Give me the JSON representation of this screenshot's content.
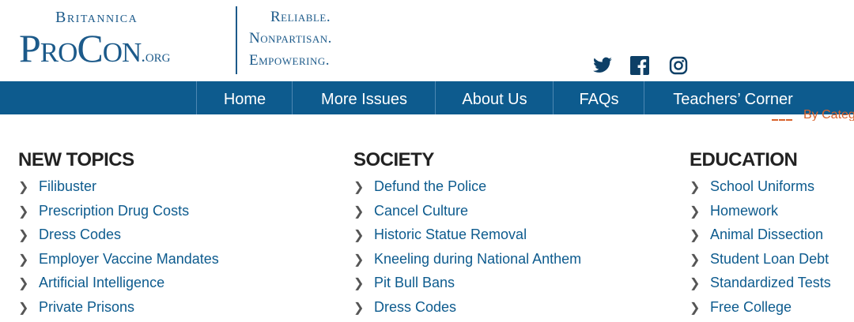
{
  "logo": {
    "top": "Britannica",
    "main": "ProCon",
    "suffix": ".org"
  },
  "tagline": [
    "Reliable.",
    "Nonpartisan.",
    "Empowering."
  ],
  "social": [
    "twitter-icon",
    "facebook-icon",
    "instagram-icon"
  ],
  "nav": [
    "Home",
    "More Issues",
    "About Us",
    "FAQs",
    "Teachers’ Corner"
  ],
  "category_link": "By Categ",
  "columns": [
    {
      "heading": "NEW TOPICS",
      "items": [
        "Filibuster",
        "Prescription Drug Costs",
        "Dress Codes",
        "Employer Vaccine Mandates",
        "Artificial Intelligence",
        "Private Prisons"
      ]
    },
    {
      "heading": "SOCIETY",
      "items": [
        "Defund the Police",
        "Cancel Culture",
        "Historic Statue Removal",
        "Kneeling during National Anthem",
        "Pit Bull Bans",
        "Dress Codes"
      ]
    },
    {
      "heading": "EDUCATION",
      "items": [
        "School Uniforms",
        "Homework",
        "Animal Dissection",
        "Student Loan Debt",
        "Standardized Tests",
        "Free College"
      ]
    }
  ],
  "colors": {
    "brand": "#1c5a8a",
    "nav": "#0d5b8e",
    "accent": "#d9622b"
  }
}
